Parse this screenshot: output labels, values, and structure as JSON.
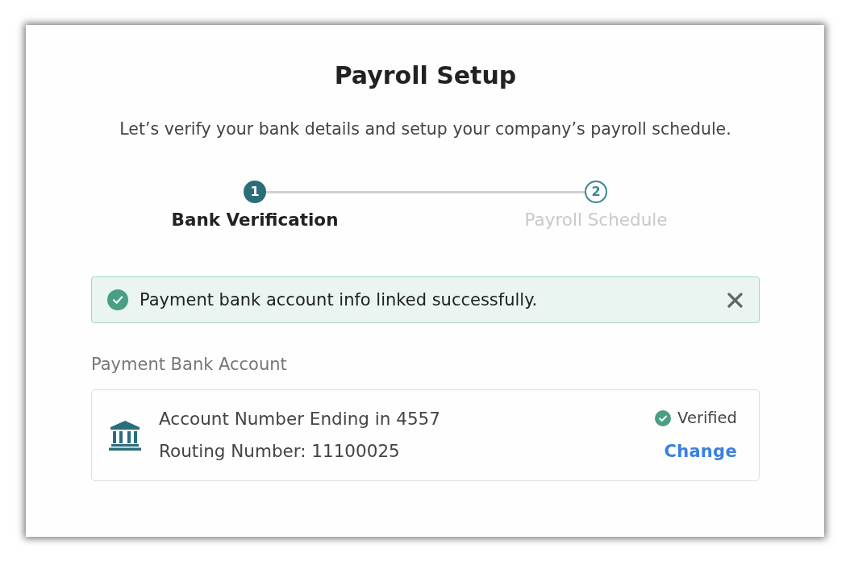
{
  "title": "Payroll Setup",
  "subtitle": "Let’s verify your bank details and setup your company’s payroll schedule.",
  "steps": [
    {
      "number": "1",
      "label": "Bank Verification",
      "selected": true
    },
    {
      "number": "2",
      "label": "Payroll Schedule",
      "selected": false
    }
  ],
  "alert": {
    "message": "Payment bank account info linked successfully."
  },
  "section_label": "Payment Bank Account",
  "account": {
    "account_number": "Account Number Ending in 4557",
    "routing_number": "Routing Number: 11100025",
    "status": "Verified",
    "action": "Change"
  }
}
